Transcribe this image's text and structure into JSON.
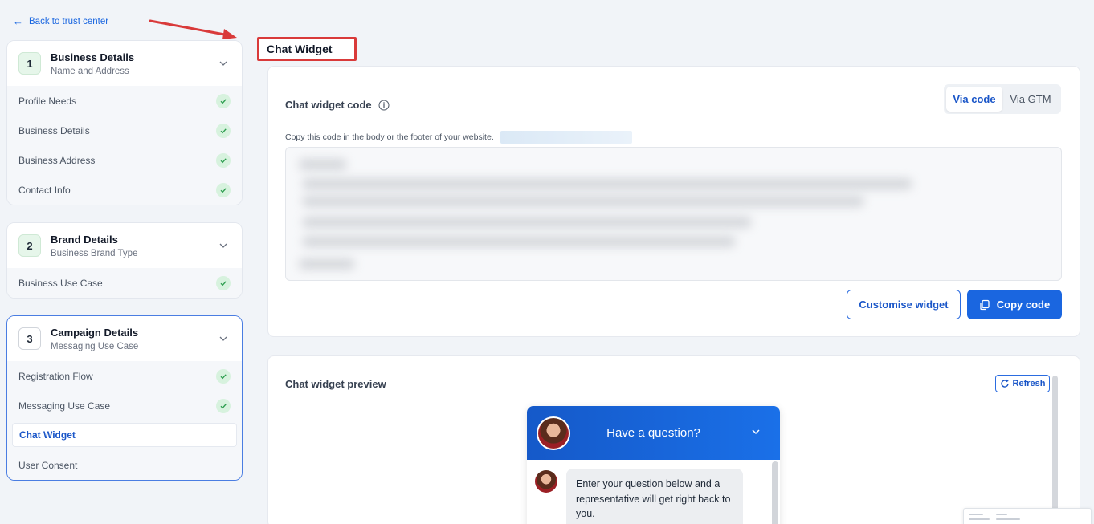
{
  "nav": {
    "back_label": "Back to trust center"
  },
  "steps": [
    {
      "number": "1",
      "title": "Business Details",
      "subtitle": "Name and Address",
      "items": [
        {
          "label": "Profile Needs",
          "done": true
        },
        {
          "label": "Business Details",
          "done": true
        },
        {
          "label": "Business Address",
          "done": true
        },
        {
          "label": "Contact Info",
          "done": true
        }
      ]
    },
    {
      "number": "2",
      "title": "Brand Details",
      "subtitle": "Business Brand Type",
      "items": [
        {
          "label": "Business Use Case",
          "done": true
        }
      ]
    },
    {
      "number": "3",
      "title": "Campaign Details",
      "subtitle": "Messaging Use Case",
      "items": [
        {
          "label": "Registration Flow",
          "done": true
        },
        {
          "label": "Messaging Use Case",
          "done": true
        },
        {
          "label": "Chat Widget",
          "done": false,
          "selected": true
        },
        {
          "label": "User Consent",
          "done": false
        }
      ]
    }
  ],
  "page": {
    "title": "Chat Widget"
  },
  "code_panel": {
    "label": "Chat widget code",
    "toggle": [
      "Via code",
      "Via GTM"
    ],
    "toggle_selected": "Via code",
    "hint": "Copy this code in the body or the footer of your website.",
    "customise_label": "Customise widget",
    "copy_label": "Copy code"
  },
  "preview_panel": {
    "label": "Chat widget preview",
    "refresh_label": "Refresh",
    "widget_title": "Have a question?",
    "message": "Enter your question below and a representative will get right back to you."
  },
  "colors": {
    "accent": "#1a66e0",
    "check_bg": "#d7f2de",
    "check_mark": "#2e9e50",
    "highlight_red": "#d93a3a"
  }
}
